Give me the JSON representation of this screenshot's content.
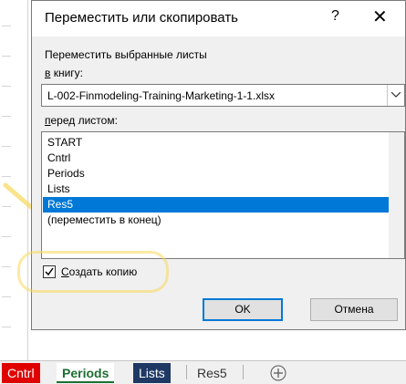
{
  "dialog": {
    "title": "Переместить или скопировать",
    "help_glyph": "?",
    "close_glyph": "✕",
    "move_label": "Переместить выбранные листы",
    "book_label_u": "в",
    "book_label_rest": " книгу:",
    "book_value": "L-002-Finmodeling-Training-Marketing-1-1.xlsx",
    "before_label_u": "п",
    "before_label_rest": "еред листом:",
    "sheets": [
      "START",
      "Cntrl",
      "Periods",
      "Lists",
      "Res5",
      "(переместить в конец)"
    ],
    "selected_sheet": "Res5",
    "copy_label_u": "С",
    "copy_label_rest": "оздать копию",
    "copy_checked": true,
    "ok_label": "OK",
    "cancel_label": "Отмена"
  },
  "tabs": [
    {
      "label": "Cntrl",
      "bg": "#e00000",
      "color": "#ffffff"
    },
    {
      "label": "Periods",
      "bg": "#ffffff",
      "color": "#1e6e32",
      "active": true
    },
    {
      "label": "Lists",
      "bg": "#1f3864",
      "color": "#ffffff"
    },
    {
      "label": "Res5",
      "bg": "#f0f0f0",
      "color": "#333333"
    }
  ],
  "colors": {
    "selection": "#0078d7",
    "highlighter": "#f7d95a"
  }
}
